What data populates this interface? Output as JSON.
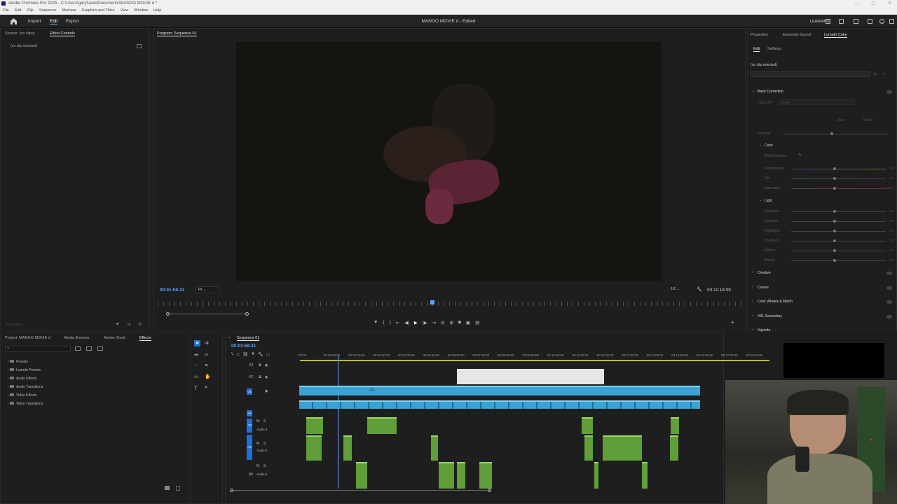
{
  "window": {
    "title": "Adobe Premiere Pro 2025 - C:\\Users\\garyt\\avid\\Documents\\MANGO MOVIE d *",
    "controls": [
      "—",
      "▢",
      "✕"
    ]
  },
  "menu": [
    "File",
    "Edit",
    "Clip",
    "Sequence",
    "Markers",
    "Graphics and Titles",
    "View",
    "Window",
    "Help"
  ],
  "appbar": {
    "tabs": [
      "Import",
      "Edit",
      "Export"
    ],
    "active_tab": "Edit",
    "document": "MANGO MOVIE d - Edited",
    "workspace": "LEARNING"
  },
  "source_panel": {
    "tabs": [
      "Source: (no clips)",
      "Effect Controls"
    ],
    "no_clip": "(no clip selected)",
    "timecode": "00:01:58:21"
  },
  "program_panel": {
    "title": "Program: Sequence 01",
    "timecode": "00:01:58:21",
    "fit": "Fit",
    "resolution": "1/2",
    "duration": "00:11:18:09",
    "playhead_fraction": 0.47
  },
  "lumetri": {
    "tabs": [
      "Properties",
      "Essential Sound",
      "Lumetri Color"
    ],
    "subtabs": [
      "Edit",
      "Settings"
    ],
    "no_clip": "(no clip selected)",
    "basic_correction": "Basic Correction",
    "input_lut": "Input LUT",
    "input_lut_value": "None",
    "auto": "Auto",
    "reset": "Reset",
    "intensity": "Intensity",
    "color": "Color",
    "white_balance": "White Balance",
    "temperature": "Temperature",
    "tint": "Tint",
    "saturation": "Saturation",
    "light": "Light",
    "light_rows": [
      "Exposure",
      "Contrast",
      "Highlights",
      "Shadows",
      "Whites",
      "Blacks"
    ],
    "values": {
      "temperature": "0.0",
      "tint": "0.0",
      "saturation": "100.0",
      "exposure": "0.0",
      "contrast": "0.0",
      "highlights": "0.0",
      "shadows": "0.0",
      "whites": "0.0",
      "blacks": "0.0"
    },
    "sections": [
      "Creative",
      "Curves",
      "Color Wheels & Match",
      "HSL Secondary",
      "Vignette"
    ]
  },
  "project_panel": {
    "tabs": [
      "Project: MANGO MOVIE d",
      "Media Browser",
      "Adobe Stock",
      "Effects"
    ],
    "bins": [
      "Presets",
      "Lumetri Presets",
      "Audio Effects",
      "Audio Transitions",
      "Video Effects",
      "Video Transitions"
    ]
  },
  "timeline": {
    "title": "Sequence 01",
    "timecode": "00:01:58:21",
    "ruler": [
      "00:00",
      "00:01:00:00",
      "00:02:00:00",
      "00:03:00:00",
      "00:04:00:00",
      "00:05:00:00",
      "00:06:00:00",
      "00:07:00:00",
      "00:08:00:00",
      "00:09:00:00",
      "00:10:00:00",
      "00:11:00:00",
      "00:12:00:00",
      "00:13:00:00",
      "00:14:00:00",
      "00:15:00:00",
      "00:16:00:00",
      "00:17:00:00",
      "00:18:00:00"
    ],
    "tracks": {
      "v3": "V3",
      "v2": "V2",
      "v1": "V1",
      "a2": "A2",
      "a3": "A3",
      "a3_name": "Audio 3",
      "a4": "A4",
      "a4_name": "Audio 4",
      "a5": "A5",
      "a5_name": "Audio 5",
      "m": "M",
      "s": "S"
    },
    "clip_label": "Clip"
  },
  "colors": {
    "accent": "#5aa6ff",
    "video_clip": "#3aa3d4",
    "audio_clip": "#5f9e38",
    "track_select": "#1e6fd9"
  }
}
